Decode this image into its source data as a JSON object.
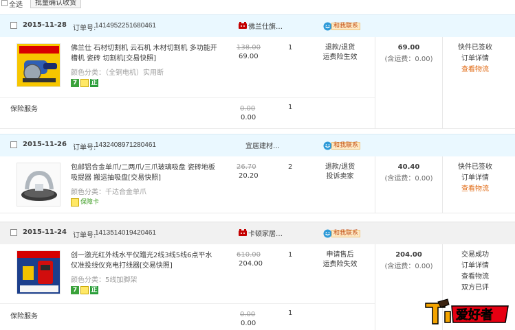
{
  "toolbar": {
    "select_all_label": "全选",
    "batch_confirm_label": "批量确认收货"
  },
  "orders": [
    {
      "date": "2015-11-28",
      "order_no_label": "订单号:",
      "order_no": "1414952251680461",
      "shop": "佛兰仕旗…",
      "contact_label": "和我联系",
      "item": {
        "title": "佛兰仕 石材切割机 云石机 木材切割机 多功能开槽机 瓷砖 切割机[交易快照]",
        "spec": "颜色分类：（全铜电机）实用断",
        "price_old": "138.00",
        "price_new": "69.00",
        "qty": "1",
        "svc1": "退款/退货",
        "svc2": "运费险生效",
        "badges": [
          "7",
          "gift",
          "正"
        ]
      },
      "insurance": {
        "label": "保险服务",
        "price_old": "0.00",
        "price_new": "0.00",
        "qty": "1"
      },
      "total": "69.00",
      "shipping": "(含运费：0.00)",
      "status": [
        "快件已签收",
        "订单详情"
      ],
      "status_link": "查看物流"
    },
    {
      "date": "2015-11-26",
      "order_no_label": "订单号:",
      "order_no": "1432408971280461",
      "shop": "宜居建材…",
      "contact_label": "和我联系",
      "item": {
        "title": "包邮铝合金单爪/二两爪/三爪玻璃吸盘 瓷砖地板吸提器 搬运抽吸盘[交易快照]",
        "spec": "颜色分类：千达合金单爪",
        "price_old": "26.70",
        "price_new": "20.20",
        "qty": "2",
        "svc1": "退款/退货",
        "svc2": "投诉卖家",
        "badge_text": "保障卡"
      },
      "total": "40.40",
      "shipping": "(含运费：0.00)",
      "status": [
        "快件已签收",
        "订单详情"
      ],
      "status_link": "查看物流"
    },
    {
      "date": "2015-11-24",
      "order_no_label": "订单号:",
      "order_no": "1413514019420461",
      "shop": "卡顿家居…",
      "contact_label": "和我联系",
      "item": {
        "title": "创一激光红外线水平仪蹭光2线3线5线6点平水仪准投线仪充电打线器[交易快照]",
        "spec": "颜色分类：5线加脚架",
        "price_old": "610.00",
        "price_new": "204.00",
        "qty": "1",
        "svc1": "申请售后",
        "svc2": "运费险失效",
        "badges": [
          "7",
          "gift",
          "正"
        ]
      },
      "insurance": {
        "label": "保险服务",
        "price_old": "0.00",
        "price_new": "0.00",
        "qty": "1"
      },
      "total": "204.00",
      "shipping": "(含运费：0.00)",
      "status": [
        "交易成功",
        "订单详情",
        "查看物流",
        "双方已评"
      ]
    }
  ],
  "watermark": {
    "text": "木工爱好者"
  },
  "colors": {
    "header_blue": "#eaf8ff",
    "header_gray": "#f1f1f1",
    "link_orange": "#e06811",
    "badge_green": "#3aa23a"
  }
}
